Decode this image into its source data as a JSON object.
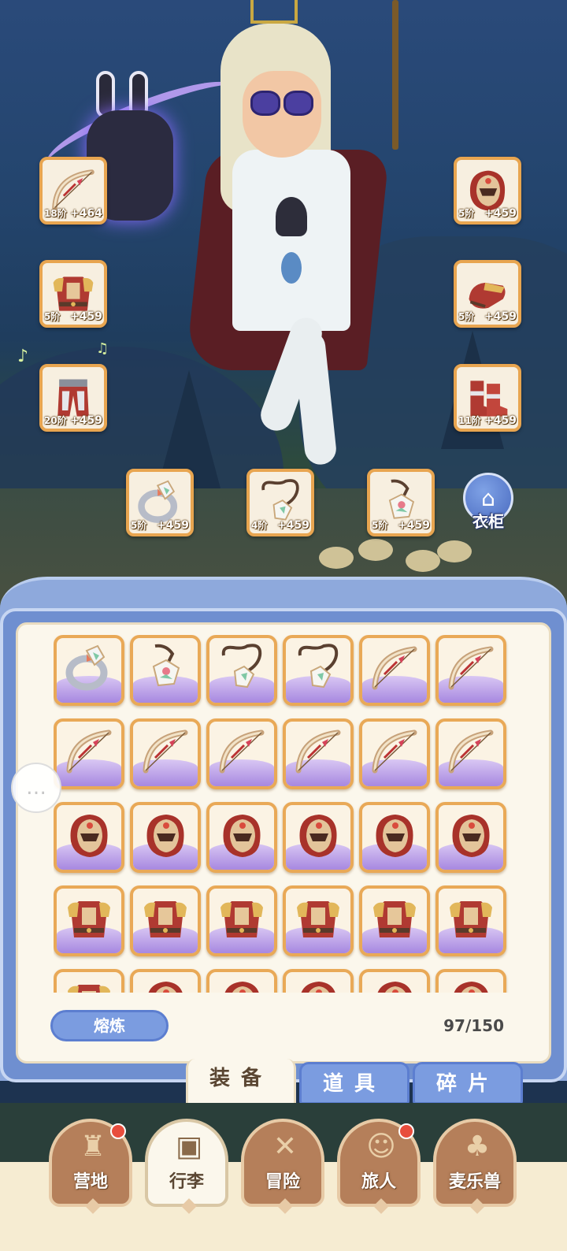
{
  "equip_slots": [
    {
      "name": "bow-slot",
      "tier": "18阶",
      "bonus": "+464",
      "icon": "bow-icon"
    },
    {
      "name": "armor-slot",
      "tier": "5阶",
      "bonus": "+459",
      "icon": "armor-icon"
    },
    {
      "name": "pants-slot",
      "tier": "20阶",
      "bonus": "+459",
      "icon": "pants-icon"
    },
    {
      "name": "helmet-slot",
      "tier": "5阶",
      "bonus": "+459",
      "icon": "helmet-icon"
    },
    {
      "name": "gloves-slot",
      "tier": "5阶",
      "bonus": "+459",
      "icon": "gloves-icon"
    },
    {
      "name": "boots-slot",
      "tier": "11阶",
      "bonus": "+459",
      "icon": "boots-icon"
    },
    {
      "name": "ring-slot",
      "tier": "5阶",
      "bonus": "+459",
      "icon": "ring-icon"
    },
    {
      "name": "necklace-slot",
      "tier": "4阶",
      "bonus": "+459",
      "icon": "necklace-icon"
    },
    {
      "name": "amulet-slot",
      "tier": "5阶",
      "bonus": "+459",
      "icon": "amulet-icon"
    }
  ],
  "wardrobe": {
    "label": "衣柜",
    "icon": "wardrobe-icon"
  },
  "inventory": {
    "rows": [
      [
        "ring-icon",
        "amulet-icon",
        "necklace-icon",
        "necklace-icon",
        "bow-icon",
        "bow-icon"
      ],
      [
        "bow-icon",
        "bow-icon",
        "bow-icon",
        "bow-icon",
        "bow-icon",
        "bow-icon"
      ],
      [
        "helmet-icon",
        "helmet-icon",
        "helmet-icon",
        "helmet-icon",
        "helmet-icon",
        "helmet-icon"
      ],
      [
        "armor-icon",
        "armor-icon",
        "armor-icon",
        "armor-icon",
        "armor-icon",
        "armor-icon"
      ],
      [
        "armor-icon",
        "helmet-icon",
        "helmet-icon",
        "helmet-icon",
        "helmet-icon",
        "helmet-icon"
      ]
    ],
    "smelt_label": "熔炼",
    "capacity": "97/150"
  },
  "tabs": [
    {
      "label": "装备",
      "active": true
    },
    {
      "label": "道具",
      "active": false
    },
    {
      "label": "碎片",
      "active": false
    }
  ],
  "nav": [
    {
      "label": "营地",
      "icon": "castle-icon",
      "badge": true,
      "active": false
    },
    {
      "label": "行李",
      "icon": "backpack-icon",
      "badge": false,
      "active": true
    },
    {
      "label": "冒险",
      "icon": "crossed-swords-icon",
      "badge": false,
      "active": false
    },
    {
      "label": "旅人",
      "icon": "traveler-icon",
      "badge": true,
      "active": false
    },
    {
      "label": "麦乐兽",
      "icon": "cat-icon",
      "badge": false,
      "active": false
    }
  ],
  "colors": {
    "slot_border": "#e8a550",
    "panel_frame": "#6f8fd0",
    "tab_inactive": "#7b9ce0",
    "nav_bg": "#b57f5a",
    "badge": "#e84d3d",
    "rarity_purple": "#a788e0"
  }
}
